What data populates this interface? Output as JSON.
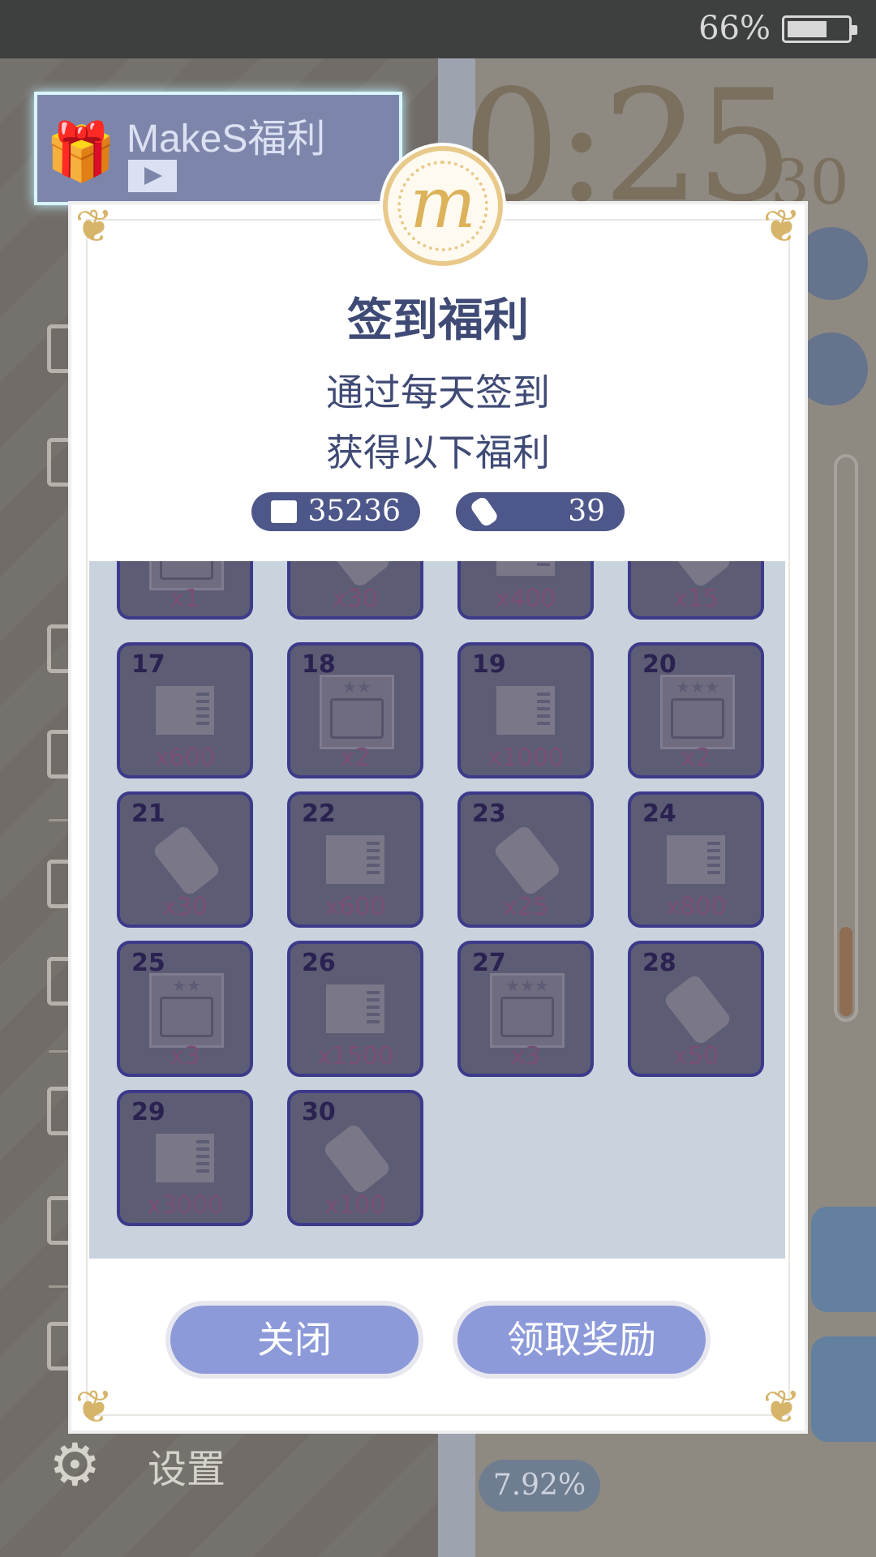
{
  "status_bar": {
    "battery_percent": "66%",
    "battery_level": 0.66
  },
  "background": {
    "banner_label": "MakeS福利",
    "clock_main": "0:25",
    "clock_seconds": "30",
    "bottom_pill": "7.92%",
    "settings_label": "设置"
  },
  "dialog": {
    "title": "签到福利",
    "subtitle_line1": "通过每天签到",
    "subtitle_line2": "获得以下福利",
    "currencies": [
      {
        "icon": "card-icon",
        "value": "35236"
      },
      {
        "icon": "ticket-icon",
        "value": "39"
      }
    ],
    "partial_row": [
      {
        "qty": "x1",
        "icon": "book"
      },
      {
        "qty": "x30",
        "icon": "ticket"
      },
      {
        "qty": "x400",
        "icon": "card"
      },
      {
        "qty": "x15",
        "icon": "ticket"
      }
    ],
    "rewards": [
      {
        "day": "17",
        "qty": "x600",
        "icon": "card"
      },
      {
        "day": "18",
        "qty": "x2",
        "icon": "book",
        "stars": "★★"
      },
      {
        "day": "19",
        "qty": "x1000",
        "icon": "card"
      },
      {
        "day": "20",
        "qty": "x2",
        "icon": "book",
        "stars": "★★★"
      },
      {
        "day": "21",
        "qty": "x30",
        "icon": "ticket"
      },
      {
        "day": "22",
        "qty": "x600",
        "icon": "card"
      },
      {
        "day": "23",
        "qty": "x25",
        "icon": "ticket"
      },
      {
        "day": "24",
        "qty": "x800",
        "icon": "card"
      },
      {
        "day": "25",
        "qty": "x3",
        "icon": "book",
        "stars": "★★"
      },
      {
        "day": "26",
        "qty": "x1500",
        "icon": "card"
      },
      {
        "day": "27",
        "qty": "x3",
        "icon": "book",
        "stars": "★★★"
      },
      {
        "day": "28",
        "qty": "x50",
        "icon": "ticket"
      },
      {
        "day": "29",
        "qty": "x3000",
        "icon": "card"
      },
      {
        "day": "30",
        "qty": "x100",
        "icon": "ticket"
      }
    ],
    "close_button": "关闭",
    "claim_button": "领取奖励"
  },
  "colors": {
    "accent": "#4d578a",
    "button": "#8c9ad9",
    "title": "#3f4a75",
    "cell_bg": "#5d5c75",
    "cell_border": "#3c3b8a"
  }
}
